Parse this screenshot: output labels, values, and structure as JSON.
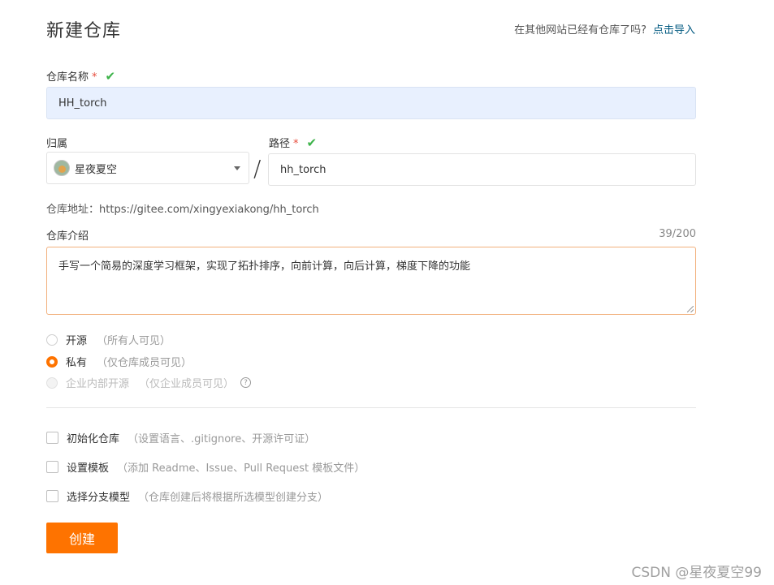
{
  "page": {
    "title": "新建仓库",
    "import_question": "在其他网站已经有仓库了吗?",
    "import_link": "点击导入"
  },
  "repo_name": {
    "label": "仓库名称",
    "required_mark": "*",
    "value": "HH_torch"
  },
  "owner": {
    "label": "归属",
    "selected": "星夜夏空"
  },
  "separator": "/",
  "path": {
    "label": "路径",
    "required_mark": "*",
    "value": "hh_torch"
  },
  "repo_address": {
    "label": "仓库地址：",
    "url": "https://gitee.com/xingyexiakong/hh_torch"
  },
  "description": {
    "label": "仓库介绍",
    "counter": "39/200",
    "value": "手写一个简易的深度学习框架，实现了拓扑排序，向前计算，向后计算，梯度下降的功能"
  },
  "visibility": {
    "options": [
      {
        "label": "开源",
        "hint": "（所有人可见）",
        "selected": false,
        "disabled": false
      },
      {
        "label": "私有",
        "hint": "（仅仓库成员可见）",
        "selected": true,
        "disabled": false
      },
      {
        "label": "企业内部开源",
        "hint": "（仅企业成员可见）",
        "selected": false,
        "disabled": true
      }
    ],
    "help_glyph": "?"
  },
  "options": {
    "items": [
      {
        "label": "初始化仓库",
        "hint": "（设置语言、.gitignore、开源许可证）",
        "checked": false
      },
      {
        "label": "设置模板",
        "hint": "（添加 Readme、Issue、Pull Request 模板文件）",
        "checked": false
      },
      {
        "label": "选择分支模型",
        "hint": "（仓库创建后将根据所选模型创建分支）",
        "checked": false
      }
    ]
  },
  "create_button": "创建",
  "watermark": "CSDN @星夜夏空99",
  "colors": {
    "accent": "#fe7300",
    "link": "#005980",
    "valid": "#3db34a",
    "required": "#e74c3c",
    "name_input_bg": "#e8f0fe"
  },
  "icons": {
    "valid": "checkmark-icon",
    "dropdown": "caret-down-icon",
    "help": "question-circle-icon"
  }
}
